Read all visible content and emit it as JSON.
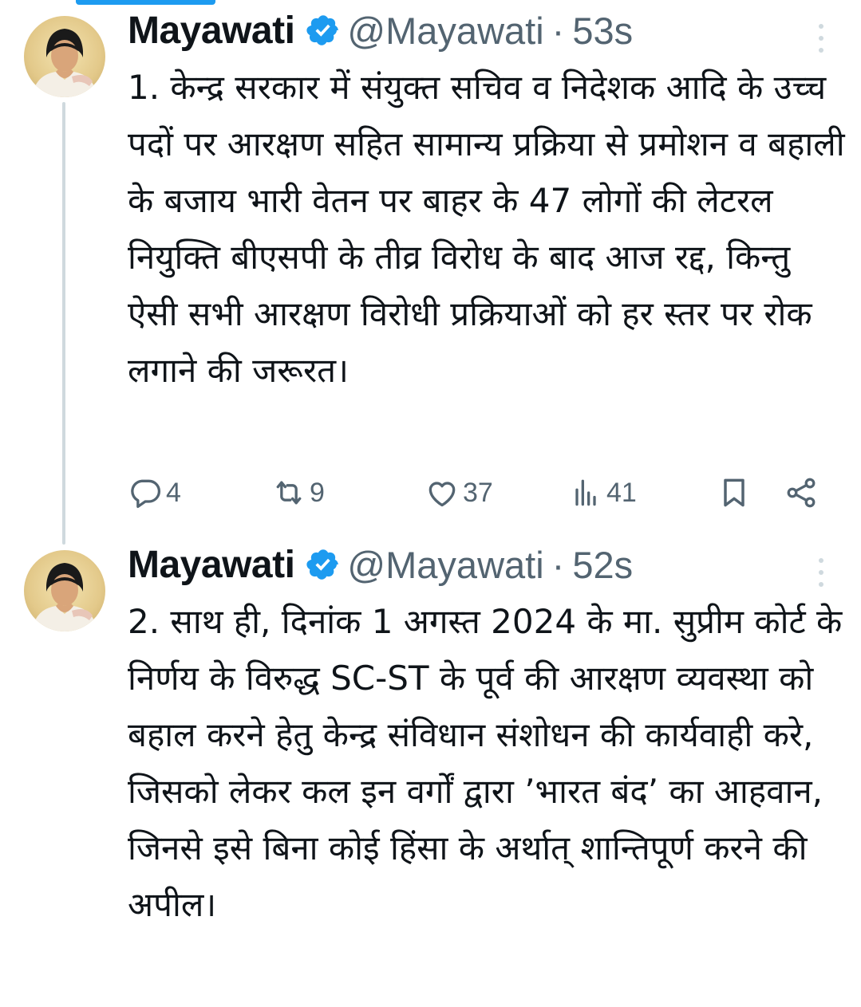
{
  "tweets": [
    {
      "author_name": "Mayawati",
      "handle": "@Mayawati",
      "separator": "·",
      "time": "53s",
      "text": "1. केन्द्र सरकार में संयुक्त सचिव व निदेशक आदि के उच्च पदों पर आरक्षण सहित सामान्य प्रक्रिया से प्रमोशन व बहाली के बजाय भारी वेतन पर बाहर के 47 लोगों की लेटरल नियुक्ति बीएसपी के तीव्र विरोध के बाद आज रद्द, किन्तु ऐसी सभी आरक्षण विरोधी प्रक्रियाओं को हर स्तर पर रोक लगाने की जरूरत।",
      "stats": {
        "replies": "4",
        "reposts": "9",
        "likes": "37",
        "views": "41"
      }
    },
    {
      "author_name": "Mayawati",
      "handle": "@Mayawati",
      "separator": "·",
      "time": "52s",
      "text": "2. साथ ही, दिनांक 1 अगस्त 2024 के मा. सुप्रीम कोर्ट के निर्णय के विरुद्ध SC-ST के पूर्व की आरक्षण व्यवस्था को बहाल करने हेतु केन्द्र संविधान संशोधन की कार्यवाही करे, जिसको लेकर कल इन वर्गों द्वारा ’भारत बंद’ का आहवान, जिनसे इसे बिना कोई हिंसा के अर्थात् शान्तिपूर्ण करने की अपील।"
    }
  ],
  "icons": {
    "verified": "verified-badge-icon",
    "more": "more-vertical-icon",
    "reply": "reply-icon",
    "repost": "repost-icon",
    "like": "heart-icon",
    "views": "views-icon",
    "bookmark": "bookmark-icon",
    "share": "share-icon"
  },
  "colors": {
    "accent": "#1d9bf0",
    "secondary_text": "#536471",
    "thread_line": "#cfd9de"
  }
}
